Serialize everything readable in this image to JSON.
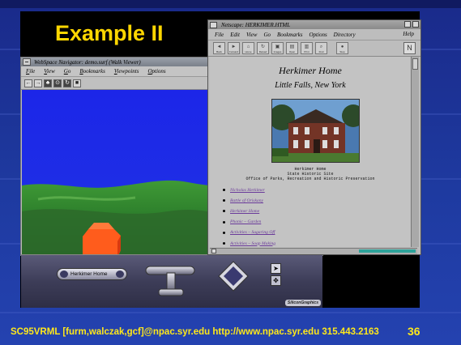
{
  "slide": {
    "title": "Example II",
    "footer": "SC95VRML   [furm,walczak,gcf]@npac.syr.edu   http://www.npac.syr.edu 315.443.2163",
    "page_number": "36"
  },
  "webspace": {
    "title": "WebSpace Navigator: demo.surf (Walk Viewer)",
    "menu": [
      "File",
      "View",
      "Go",
      "Bookmarks",
      "Viewpoints",
      "Options"
    ],
    "toolbar_icons": [
      "back-arrow-icon",
      "forward-arrow-icon",
      "walk-icon",
      "seek-icon",
      "reload-icon",
      "stop-icon"
    ]
  },
  "navigator_panel": {
    "viewpoint_label": "Herkimer Home",
    "brand": "SiliconGraphics"
  },
  "netscape": {
    "title": "Netscape: HERKIMER.HTML",
    "menu": [
      "File",
      "Edit",
      "View",
      "Go",
      "Bookmarks",
      "Options",
      "Directory"
    ],
    "help": "Help",
    "toolbar": [
      {
        "label": "Back",
        "glyph": "◄"
      },
      {
        "label": "Forward",
        "glyph": "►"
      },
      {
        "label": "Home",
        "glyph": "⌂"
      },
      {
        "label": "Reload",
        "glyph": "↻"
      },
      {
        "label": "Images",
        "glyph": "▣"
      },
      {
        "label": "Open",
        "glyph": "▤"
      },
      {
        "label": "Print",
        "glyph": "▥"
      },
      {
        "label": "Find",
        "glyph": "⌕"
      },
      {
        "label": "Stop",
        "glyph": "●"
      }
    ],
    "page": {
      "heading": "Herkimer Home",
      "subheading": "Little Falls, New York",
      "caption_lines": [
        "Herkimer Home",
        "State Historic Site",
        "Office of Parks, Recreation and Historic Preservation"
      ],
      "links": [
        "Nicholas Herkimer",
        "Battle of Oriskany",
        "Herkimer Home",
        "Phonic – Garden",
        "Activities – Sugaring Off",
        "Activities – Soap Making"
      ]
    },
    "progress": 0.3,
    "colors": {
      "link": "#6a3a9a",
      "progress": "#2ea39a"
    }
  },
  "colors": {
    "title_yellow": "#ffd700",
    "footer_yellow": "#ffe81a",
    "background_blue": "#1e3aa0",
    "sky_blue": "#1e2ee6",
    "terrain_green": "#2f7a2a",
    "house_orange": "#ff5a1a"
  }
}
